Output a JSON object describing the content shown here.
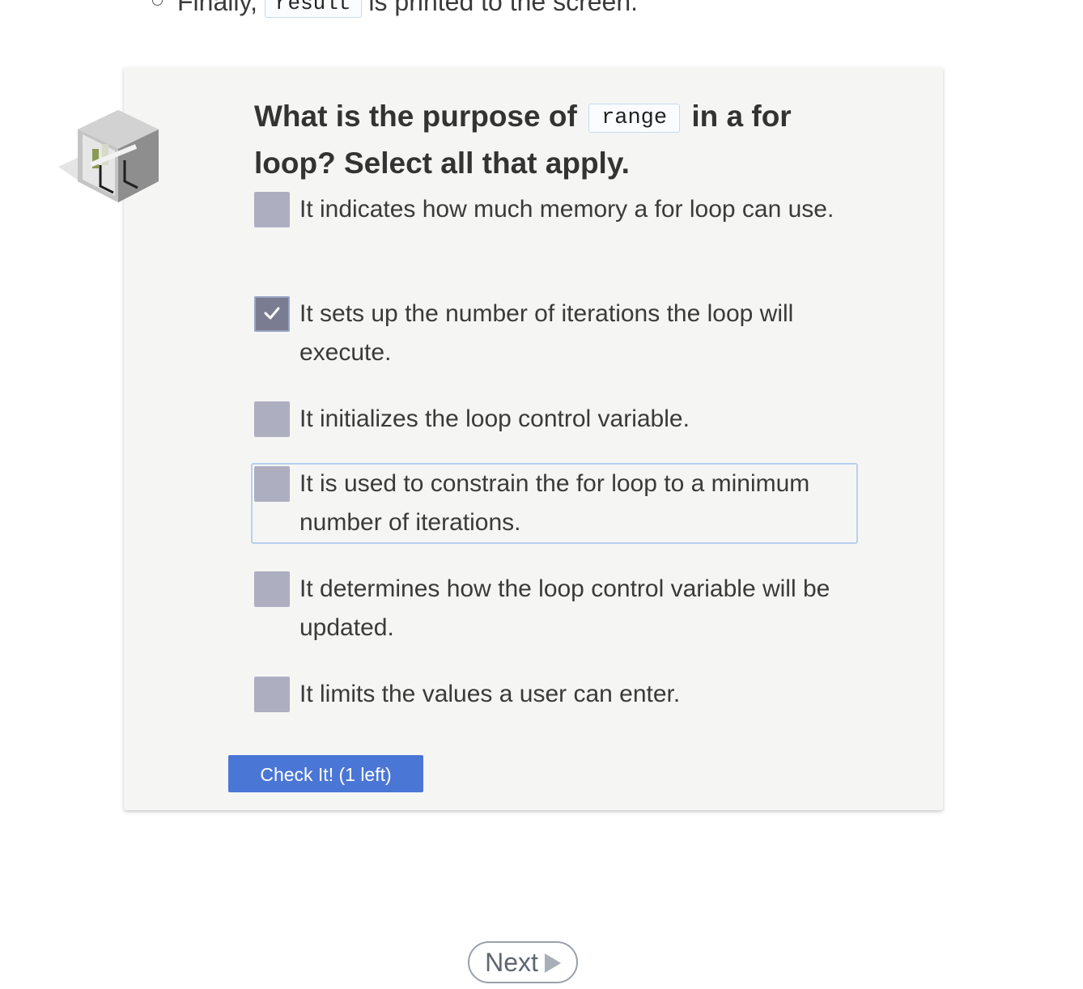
{
  "previous_content": {
    "before": "Finally,",
    "code": "result",
    "after": "is printed to the screen."
  },
  "question": {
    "before": "What is the purpose of",
    "code": "range",
    "after": "in a for loop? Select all that apply."
  },
  "options": [
    {
      "label": "It indicates how much memory a for loop can use.",
      "checked": false
    },
    {
      "label": "It sets up the number of iterations the loop will execute.",
      "checked": true
    },
    {
      "label": "It initializes the loop control variable.",
      "checked": false
    },
    {
      "label": "It is used to constrain the for loop to a minimum number of iterations.",
      "checked": false,
      "focused": true
    },
    {
      "label": "It determines how the loop control variable will be updated.",
      "checked": false
    },
    {
      "label": "It limits the values a user can enter.",
      "checked": false
    }
  ],
  "check_button": {
    "label": "Check It! (1 left)"
  },
  "next_button": {
    "label": "Next"
  },
  "colors": {
    "card_bg": "#f5f6f4",
    "checkbox": "#adaec0",
    "checkbox_checked": "#7a7d92",
    "primary_button": "#4a76d6",
    "focus_outline": "#b7cff0"
  },
  "icons": {
    "question_cube": "isometric-room-cube-icon",
    "next": "play-triangle-icon",
    "checkmark": "checkmark-icon"
  }
}
